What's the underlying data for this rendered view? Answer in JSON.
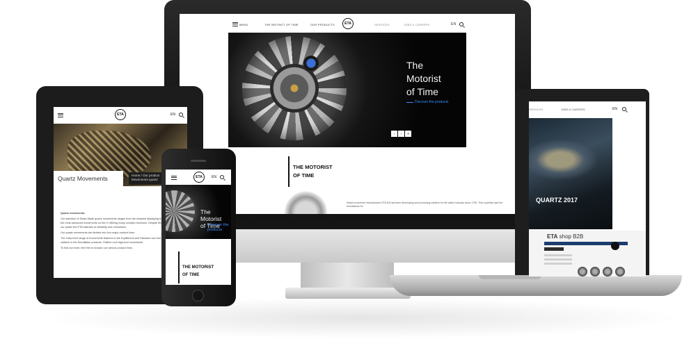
{
  "imac": {
    "nav": {
      "menu": "MENU",
      "item1": "THE INSTINCT OF TIME",
      "item2": "OUR PRODUCTS",
      "item3": "SERVICES",
      "item4": "JOBS & CAREERS",
      "lang": "EN",
      "logo": "ETA"
    },
    "hero": {
      "title_line1": "The",
      "title_line2": "Motorist",
      "title_line3": "of Time",
      "cta": "Discover the products",
      "pager": [
        "‹",
        "›",
        "⏸"
      ]
    },
    "section": {
      "title_line1": "THE MOTORIST",
      "title_line2": "OF TIME",
      "text": "Swiss movement manufacturer ETA SA has been developing and producing calibers for the watch industry since 1793. This expertise laid the foundations for"
    }
  },
  "laptop": {
    "nav": {
      "item1": "SERVICES",
      "item2": "JOBS & CAREERS",
      "lang": "EN"
    },
    "hero_title": "QUARTZ 2017",
    "shop": {
      "brand": "ETA",
      "suffix": "shop B2B"
    }
  },
  "tablet": {
    "nav": {
      "lang": "EN",
      "logo": "ETA"
    },
    "page_label": "Quartz Movements",
    "breadcrumb_line1": "Home / Our product",
    "breadcrumb_line2": "Movements quartz",
    "text": {
      "heading": "Quartz movements:",
      "p1": "Our selection of Swiss Made quartz movements ranges from the simplest displaying hours and minutes, to the most advanced movements on the m offering many complex functions. Despite their wide variety, all our quartz the ETA hallmark of reliability and robustness.",
      "p2": "Our quartz movements are divided into four major product lines.",
      "p3": "The entry-level range of movements features in the Equilibrium and Standard can find the mid-range calibers in the NormBalan products. Flatline cont high-end movements.",
      "p4": "To find out more, feel free to browse our various product lines."
    }
  },
  "phone": {
    "nav": {
      "lang": "EN",
      "logo": "ETA"
    },
    "hero": {
      "title_line1": "The Motorist",
      "title_line2": "of Time",
      "cta_line1": "Discover the",
      "cta_line2": "products",
      "pager": [
        "‹",
        "⏸",
        "›"
      ]
    },
    "section": {
      "title_line1": "THE MOTORIST",
      "title_line2": "OF TIME"
    }
  },
  "colors": {
    "accent_blue": "#3a8dff",
    "shop_navy": "#1c3c6e"
  }
}
